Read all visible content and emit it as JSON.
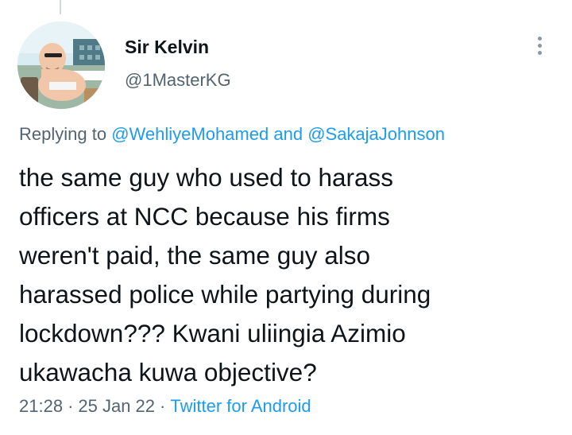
{
  "tweet": {
    "author": {
      "display_name": "Sir Kelvin",
      "handle": "@1MasterKG"
    },
    "reply_context": {
      "prefix": "Replying to",
      "mention_1": "@WehliyeMohamed",
      "connector": "and",
      "mention_2": "@SakajaJohnson"
    },
    "text": "the same guy who used to harass\nofficers at NCC because his firms\nweren't paid, the same guy also\nharassed police while partying during\nlockdown??? Kwani uliingia Azimio\nukawacha kuwa objective?",
    "time": "21:28",
    "dot": "·",
    "date": "25 Jan 22",
    "source": "Twitter for Android"
  },
  "icons": {
    "more": "more-vertical-icon",
    "avatar": "profile-avatar"
  },
  "colors": {
    "link": "#1d9bf0",
    "secondary_text": "#536471",
    "primary_text": "#0f1419"
  }
}
